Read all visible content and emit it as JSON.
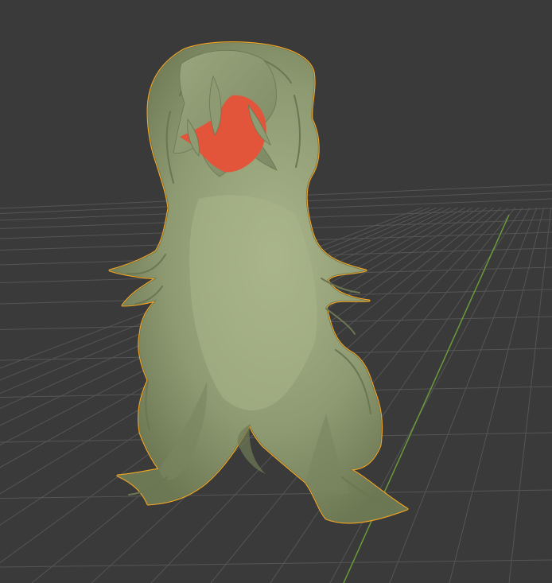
{
  "viewport": {
    "background": "#3a3a3a",
    "grid_color": "#555555",
    "y_axis_color": "#6a9a3a",
    "selection_outline_color": "#f5a623"
  },
  "object": {
    "selected": true,
    "body_color": "#8f9c73",
    "body_highlight": "#a8b48b",
    "body_shadow": "#6b7652",
    "face_color": "#e2553a"
  }
}
